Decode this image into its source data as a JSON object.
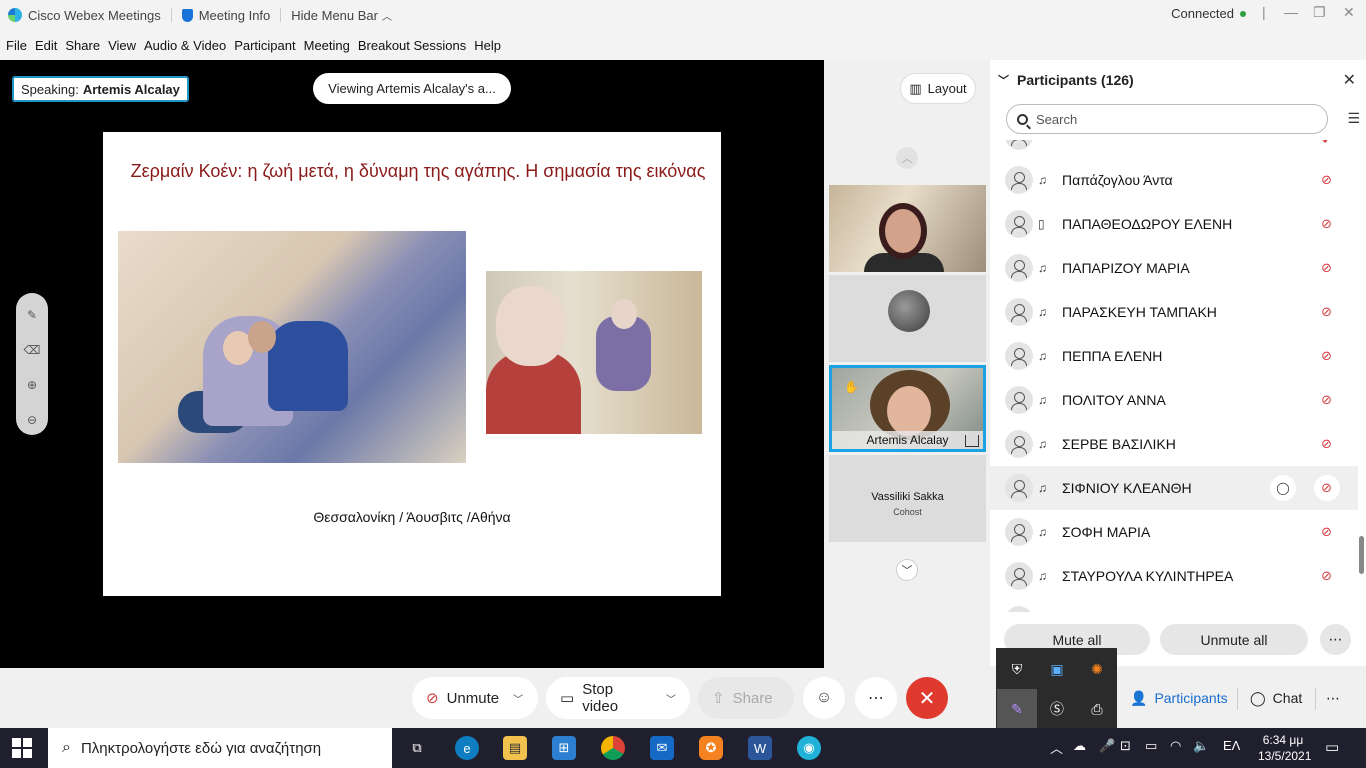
{
  "titlebar": {
    "app_name": "Cisco Webex Meetings",
    "meeting_info": "Meeting Info",
    "hide_menu": "Hide Menu Bar",
    "status": "Connected"
  },
  "menu": [
    "File",
    "Edit",
    "Share",
    "View",
    "Audio & Video",
    "Participant",
    "Meeting",
    "Breakout Sessions",
    "Help"
  ],
  "stage": {
    "speaking_label": "Speaking:",
    "speaking_name": "Artemis Alcalay",
    "viewing": "Viewing Artemis Alcalay's a...",
    "slide_title": "Ζερμαίν Κοέν: η ζωή μετά, η δύναμη της αγάπης. Η σημασία της εικόνας",
    "slide_caption": "Θεσσαλονίκη / Άουσβιτς /Αθήνα"
  },
  "strip": {
    "layout_label": "Layout",
    "active_speaker_name": "Artemis Alcalay",
    "tile4_name": "Vassiliki Sakka",
    "tile4_role": "Cohost"
  },
  "panel": {
    "title": "Participants (126)",
    "search_placeholder": "Search",
    "participants": [
      {
        "name": "Παπάζογλου Άντα",
        "device": "headset"
      },
      {
        "name": "ΠΑΠΑΘΕΟΔΩΡΟΥ ΕΛΕΝΗ",
        "device": "mobile"
      },
      {
        "name": "ΠΑΠΑΡΙΖΟΥ ΜΑΡΙΑ",
        "device": "headset"
      },
      {
        "name": "ΠΑΡΑΣΚΕΥΗ ΤΑΜΠΑΚΗ",
        "device": "headset"
      },
      {
        "name": "ΠΕΠΠΑ ΕΛΕΝΗ",
        "device": "headset"
      },
      {
        "name": "ΠΟΛΙΤΟΥ ΑΝΝΑ",
        "device": "headset"
      },
      {
        "name": "ΣΕΡΒΕ ΒΑΣΙΛΙΚΗ",
        "device": "headset"
      },
      {
        "name": "ΣΙΦΝΙΟΥ ΚΛΕΑΝΘΗ",
        "device": "headset"
      },
      {
        "name": "ΣΟΦΗ ΜΑΡΙΑ",
        "device": "headset"
      },
      {
        "name": "ΣΤΑΥΡΟΥΛΑ ΚΥΛΙΝΤΗΡΕΑ",
        "device": "headset"
      }
    ],
    "mute_all": "Mute all",
    "unmute_all": "Unmute all"
  },
  "controls": {
    "unmute": "Unmute",
    "stop_video": "Stop video",
    "share": "Share",
    "participants": "Participants",
    "chat": "Chat"
  },
  "taskbar": {
    "search_placeholder": "Πληκτρολογήστε εδώ για αναζήτηση",
    "language": "ΕΛ",
    "time": "6:34 μμ",
    "date": "13/5/2021"
  },
  "colors": {
    "accent": "#1ba2e0",
    "end_call": "#e03a2f",
    "slide_title": "#8b1a1a",
    "muted": "#d13b3b"
  }
}
